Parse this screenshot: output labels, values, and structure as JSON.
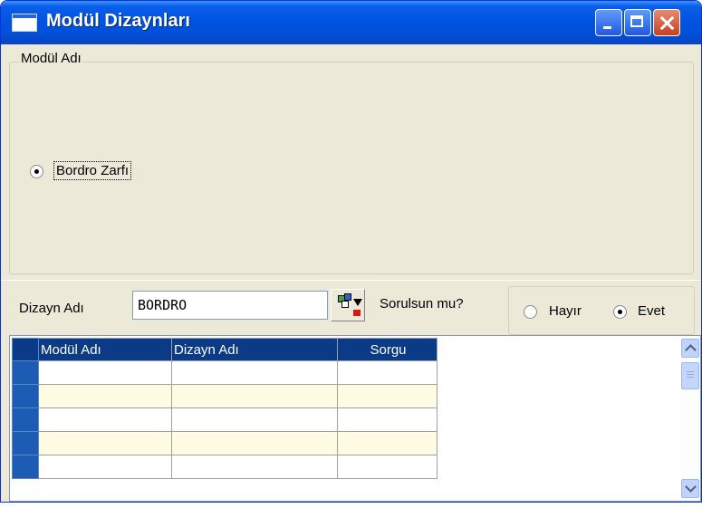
{
  "window": {
    "title": "Modül Dizaynları"
  },
  "module_group": {
    "legend": "Modül Adı",
    "options": [
      {
        "label": "Bordro Zarfı",
        "checked": true
      }
    ]
  },
  "design": {
    "label": "Dizayn Adı",
    "value": "BORDRO",
    "picker_icon": "select-list-icon"
  },
  "ask": {
    "label": "Sorulsun mu?",
    "options": [
      {
        "label": "Hayır",
        "checked": false
      },
      {
        "label": "Evet",
        "checked": true
      }
    ]
  },
  "grid": {
    "columns": [
      "Modül Adı",
      "Dizayn Adı",
      "Sorgu"
    ],
    "rows": [
      [
        "",
        "",
        ""
      ],
      [
        "",
        "",
        ""
      ],
      [
        "",
        "",
        ""
      ],
      [
        "",
        "",
        ""
      ],
      [
        "",
        "",
        ""
      ]
    ],
    "alt_row_color": "#fffbe3",
    "header_color": "#0b3a86"
  }
}
